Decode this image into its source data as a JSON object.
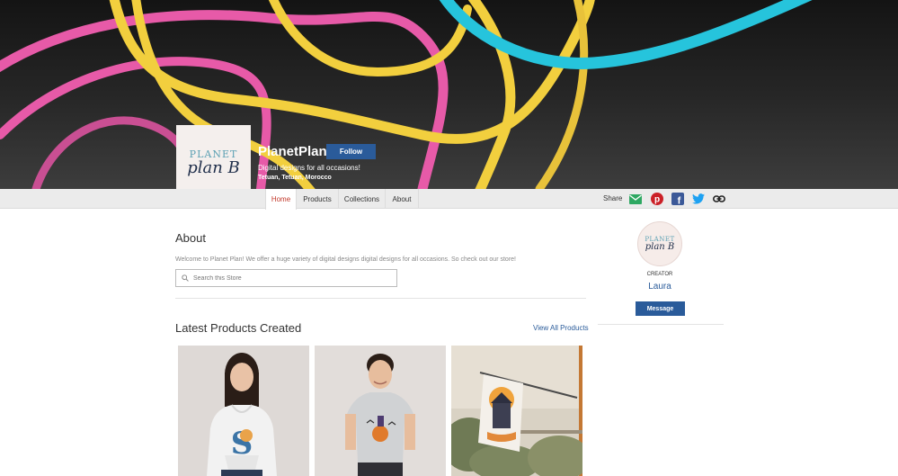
{
  "store": {
    "name": "PlanetPlanB",
    "follow_label": "Follow",
    "tagline": "Digital designs for all occasions!",
    "location": "Tetuan, Tetuan, Morocco",
    "logo_line1": "PLANET",
    "logo_line2": "plan B"
  },
  "nav": {
    "tabs": [
      {
        "label": "Home",
        "active": true
      },
      {
        "label": "Products",
        "active": false
      },
      {
        "label": "Collections",
        "active": false
      },
      {
        "label": "About",
        "active": false
      }
    ],
    "share_label": "Share",
    "share_icons": [
      "email-icon",
      "pinterest-icon",
      "facebook-icon",
      "twitter-icon",
      "link-icon"
    ]
  },
  "about": {
    "title": "About",
    "text": "Welcome to Planet Plan! We offer a huge variety of digital designs digital designs for all occasions. So check out our store!"
  },
  "search": {
    "placeholder": "Search this Store"
  },
  "latest": {
    "title": "Latest Products Created",
    "view_all": "View All Products"
  },
  "creator": {
    "label": "CREATOR",
    "name": "Laura",
    "message_label": "Message",
    "avatar_line1": "PLANET",
    "avatar_line2": "plan B"
  },
  "colors": {
    "accent": "#2a5b9a",
    "active_tab": "#c2392b",
    "banner_pink": "#e75aa8",
    "banner_yellow": "#f2cf3e",
    "banner_cyan": "#26c4dc"
  }
}
